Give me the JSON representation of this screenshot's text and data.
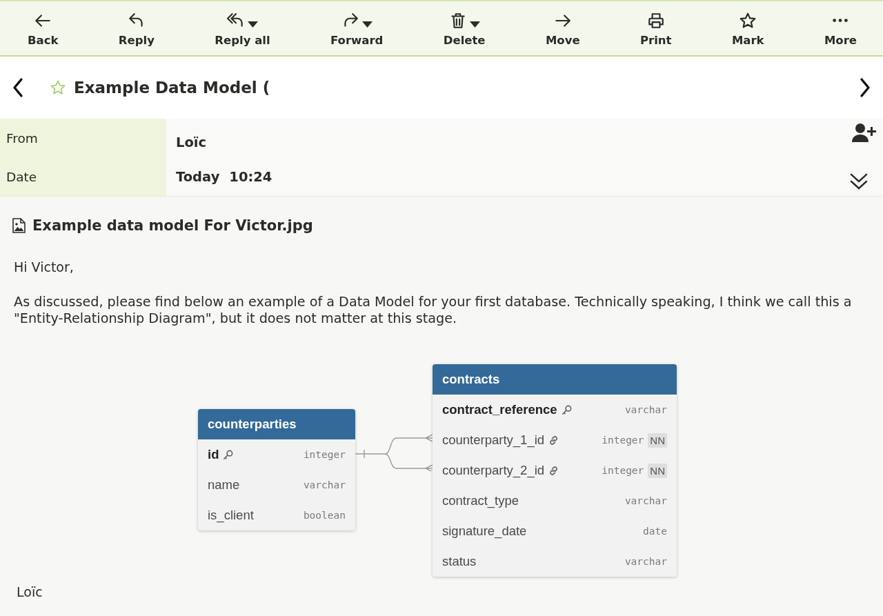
{
  "toolbar": {
    "buttons": [
      {
        "label": "Back",
        "dropdown": false
      },
      {
        "label": "Reply",
        "dropdown": false
      },
      {
        "label": "Reply all",
        "dropdown": true
      },
      {
        "label": "Forward",
        "dropdown": true
      },
      {
        "label": "Delete",
        "dropdown": true
      },
      {
        "label": "Move",
        "dropdown": false
      },
      {
        "label": "Print",
        "dropdown": false
      },
      {
        "label": "Mark",
        "dropdown": false
      },
      {
        "label": "More",
        "dropdown": false
      }
    ]
  },
  "message": {
    "subject": "Example Data Model (",
    "starred": false
  },
  "header": {
    "from": {
      "label": "From",
      "value": "Loïc"
    },
    "date": {
      "label": "Date",
      "day": "Today",
      "time": "10:24"
    }
  },
  "attachment": {
    "filename": "Example data model For Victor.jpg"
  },
  "body": {
    "greeting": "Hi Victor,",
    "paragraph": "As discussed, please find below an example of a Data Model for your first database. Technically speaking, I think we call this a \"Entity-Relationship Diagram\", but it does not matter at this stage.",
    "diagram": {
      "tables": [
        {
          "name": "counterparties",
          "columns": [
            {
              "name": "id",
              "type": "integer",
              "kind": "primary_key"
            },
            {
              "name": "name",
              "type": "varchar",
              "kind": "plain"
            },
            {
              "name": "is_client",
              "type": "boolean",
              "kind": "plain"
            }
          ]
        },
        {
          "name": "contracts",
          "columns": [
            {
              "name": "contract_reference",
              "type": "varchar",
              "kind": "primary_key"
            },
            {
              "name": "counterparty_1_id",
              "type": "integer",
              "kind": "foreign_key",
              "badge": "NN"
            },
            {
              "name": "counterparty_2_id",
              "type": "integer",
              "kind": "foreign_key",
              "badge": "NN"
            },
            {
              "name": "contract_type",
              "type": "varchar",
              "kind": "plain"
            },
            {
              "name": "signature_date",
              "type": "date",
              "kind": "plain"
            },
            {
              "name": "status",
              "type": "varchar",
              "kind": "plain"
            }
          ]
        }
      ]
    },
    "signature": "Loïc"
  }
}
